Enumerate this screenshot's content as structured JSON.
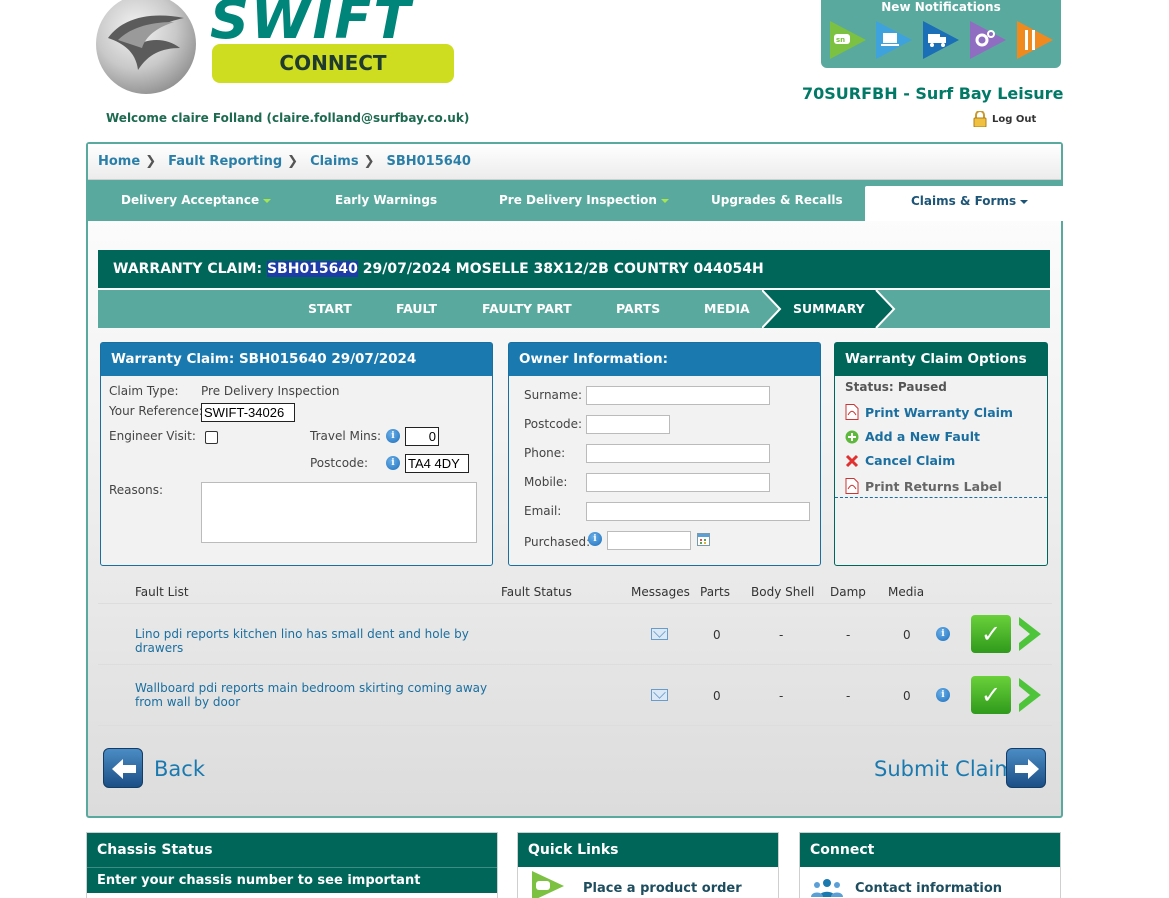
{
  "header": {
    "logo_text": "SWIFT",
    "logo_sub": "CONNECT",
    "welcome": "Welcome claire Folland (claire.folland@surfbay.co.uk)",
    "notifications_title": "New Notifications",
    "notification_icons": [
      "caravan-icon",
      "laptop-icon",
      "truck-icon",
      "gears-icon",
      "tools-icon"
    ],
    "dealer": "70SURFBH - Surf Bay Leisure",
    "logout": "Log Out"
  },
  "breadcrumb": [
    "Home",
    "Fault Reporting",
    "Claims",
    "SBH015640"
  ],
  "nav": {
    "items": [
      "Delivery Acceptance",
      "Early Warnings",
      "Pre Delivery Inspection",
      "Upgrades & Recalls",
      "Claims & Forms"
    ],
    "active": "Claims & Forms"
  },
  "claim": {
    "prefix": "WARRANTY CLAIM: ",
    "number": "SBH015640",
    "rest": " 29/07/2024 MOSELLE 38X12/2B COUNTRY 044054H"
  },
  "steps": [
    "START",
    "FAULT",
    "FAULTY PART",
    "PARTS",
    "MEDIA",
    "SUMMARY"
  ],
  "warranty_panel": {
    "title": "Warranty Claim: SBH015640 29/07/2024",
    "claim_type_label": "Claim Type:",
    "claim_type_value": "Pre Delivery Inspection",
    "reference_label": "Your Reference:",
    "reference_value": "SWIFT-34026",
    "engineer_label": "Engineer Visit:",
    "travel_label": "Travel Mins:",
    "travel_value": "0",
    "postcode_label": "Postcode:",
    "postcode_value": "TA4 4DY",
    "reasons_label": "Reasons:"
  },
  "owner_panel": {
    "title": "Owner Information:",
    "surname_label": "Surname:",
    "postcode_label": "Postcode:",
    "phone_label": "Phone:",
    "mobile_label": "Mobile:",
    "email_label": "Email:",
    "purchased_label": "Purchased:"
  },
  "options_panel": {
    "title": "Warranty Claim Options",
    "status": "Status: Paused",
    "print_claim": "Print Warranty Claim",
    "add_fault": "Add a New Fault",
    "cancel_claim": "Cancel Claim",
    "print_returns": "Print Returns Label"
  },
  "fault_list": {
    "headers": {
      "list": "Fault List",
      "status": "Fault Status",
      "messages": "Messages",
      "parts": "Parts",
      "body_shell": "Body Shell",
      "damp": "Damp",
      "media": "Media"
    },
    "rows": [
      {
        "text": "Lino pdi reports kitchen lino has small dent and hole by drawers",
        "parts": "0",
        "body_shell": "-",
        "damp": "-",
        "media": "0"
      },
      {
        "text": "Wallboard pdi reports main bedroom skirting coming away from wall by door",
        "parts": "0",
        "body_shell": "-",
        "damp": "-",
        "media": "0"
      }
    ]
  },
  "footer_buttons": {
    "back": "Back",
    "submit": "Submit Claim"
  },
  "bottom": {
    "chassis_title": "Chassis Status",
    "chassis_sub": "Enter your chassis number to see important notifications:",
    "quick_title": "Quick Links",
    "quick_link": "Place a product order",
    "connect_title": "Connect",
    "connect_link": "Contact information"
  },
  "colors": {
    "teal": "#5aa99e",
    "dark_teal": "#00665a",
    "blue": "#1a7ab0",
    "lime": "#cedd20",
    "green": "#3eb52a"
  }
}
